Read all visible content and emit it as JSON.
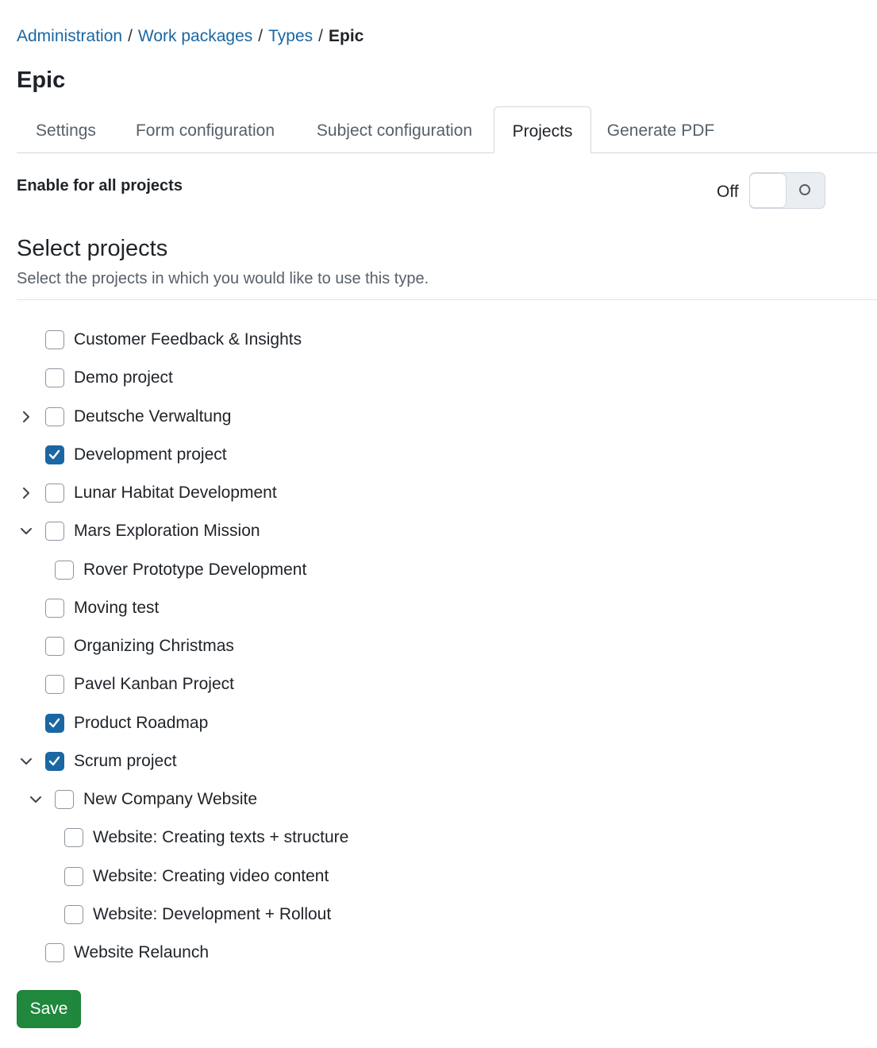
{
  "breadcrumb": {
    "items": [
      "Administration",
      "Work packages",
      "Types"
    ],
    "separator": "/",
    "current": "Epic"
  },
  "page": {
    "title": "Epic"
  },
  "tabs": [
    {
      "label": "Settings",
      "selected": false
    },
    {
      "label": "Form configuration",
      "selected": false
    },
    {
      "label": "Subject configuration",
      "selected": false
    },
    {
      "label": "Projects",
      "selected": true
    },
    {
      "label": "Generate PDF",
      "selected": false
    }
  ],
  "enable_all": {
    "label": "Enable for all projects",
    "state_text": "Off",
    "on": false
  },
  "select_projects": {
    "title": "Select projects",
    "description": "Select the projects in which you would like to use this type."
  },
  "projects": [
    {
      "label": "Customer Feedback & Insights",
      "level": 0,
      "checked": false,
      "expander": "none"
    },
    {
      "label": "Demo project",
      "level": 0,
      "checked": false,
      "expander": "none"
    },
    {
      "label": "Deutsche Verwaltung",
      "level": 0,
      "checked": false,
      "expander": "collapsed"
    },
    {
      "label": "Development project",
      "level": 0,
      "checked": true,
      "expander": "none"
    },
    {
      "label": "Lunar Habitat Development",
      "level": 0,
      "checked": false,
      "expander": "collapsed"
    },
    {
      "label": "Mars Exploration Mission",
      "level": 0,
      "checked": false,
      "expander": "expanded"
    },
    {
      "label": "Rover Prototype Development",
      "level": 1,
      "checked": false,
      "expander": "none"
    },
    {
      "label": "Moving test",
      "level": 0,
      "checked": false,
      "expander": "none"
    },
    {
      "label": "Organizing Christmas",
      "level": 0,
      "checked": false,
      "expander": "none"
    },
    {
      "label": "Pavel Kanban Project",
      "level": 0,
      "checked": false,
      "expander": "none"
    },
    {
      "label": "Product Roadmap",
      "level": 0,
      "checked": true,
      "expander": "none"
    },
    {
      "label": "Scrum project",
      "level": 0,
      "checked": true,
      "expander": "expanded"
    },
    {
      "label": "New Company Website",
      "level": 1,
      "checked": false,
      "expander": "expanded"
    },
    {
      "label": "Website: Creating texts + structure",
      "level": 2,
      "checked": false,
      "expander": "none"
    },
    {
      "label": "Website: Creating video content",
      "level": 2,
      "checked": false,
      "expander": "none"
    },
    {
      "label": "Website: Development + Rollout",
      "level": 2,
      "checked": false,
      "expander": "none"
    },
    {
      "label": "Website Relaunch",
      "level": 0,
      "checked": false,
      "expander": "none"
    }
  ],
  "actions": {
    "save_label": "Save"
  },
  "colors": {
    "link": "#1a67a3",
    "checkbox_checked": "#1a67a3",
    "save_button": "#1f883d"
  }
}
